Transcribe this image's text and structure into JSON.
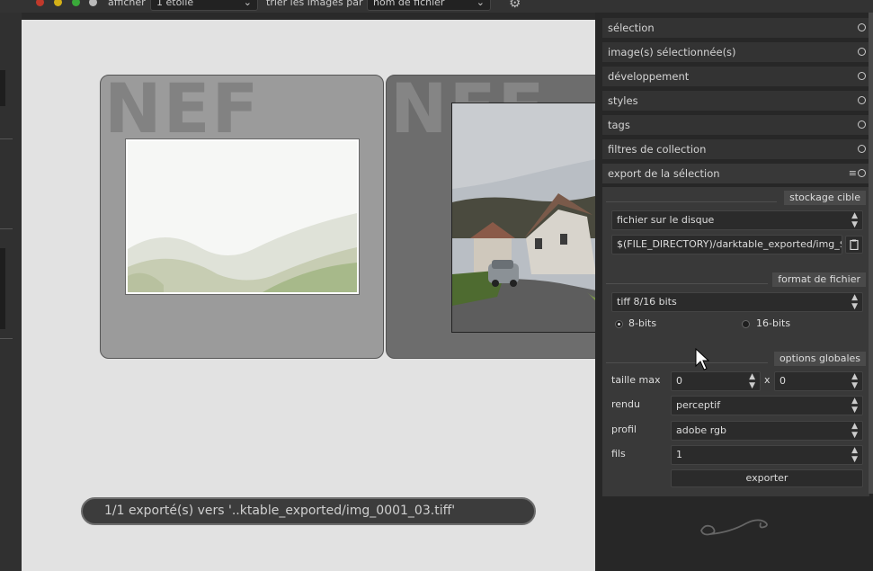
{
  "window": {
    "traffic_lights": [
      "#c0392b",
      "#d4b017",
      "#3aa93a",
      "#bbbbbb"
    ]
  },
  "toolbar": {
    "show_label": "afficher",
    "rating_value": "1 étoile",
    "sort_label": "trier les images par",
    "sort_value": "nom de fichier",
    "settings_icon": "gear-icon"
  },
  "lighttable": {
    "thumbnails": [
      {
        "extension": "NEF"
      },
      {
        "extension": "NEF"
      }
    ],
    "toast": "1/1 exporté(s) vers '..ktable_exported/img_0001_03.tiff'"
  },
  "right_panel": {
    "modules": [
      {
        "label": "sélection"
      },
      {
        "label": "image(s) sélectionnée(s)"
      },
      {
        "label": "développement"
      },
      {
        "label": "styles"
      },
      {
        "label": "tags"
      },
      {
        "label": "filtres de collection"
      },
      {
        "label": "export de la sélection"
      }
    ],
    "export": {
      "storage_section": "stockage cible",
      "storage_value": "fichier sur le disque",
      "path_value": "$(FILE_DIRECTORY)/darktable_exported/img_$(",
      "format_section": "format de fichier",
      "format_value": "tiff 8/16 bits",
      "bit_options": [
        {
          "label": "8-bits",
          "selected": true
        },
        {
          "label": "16-bits",
          "selected": false
        }
      ],
      "global_section": "options globales",
      "max_size_label": "taille max",
      "max_width": "0",
      "max_sep": "x",
      "max_height": "0",
      "intent_label": "rendu",
      "intent_value": "perceptif",
      "profile_label": "profil",
      "profile_value": "adobe rgb",
      "threads_label": "fils",
      "threads_value": "1",
      "export_button": "exporter"
    }
  }
}
